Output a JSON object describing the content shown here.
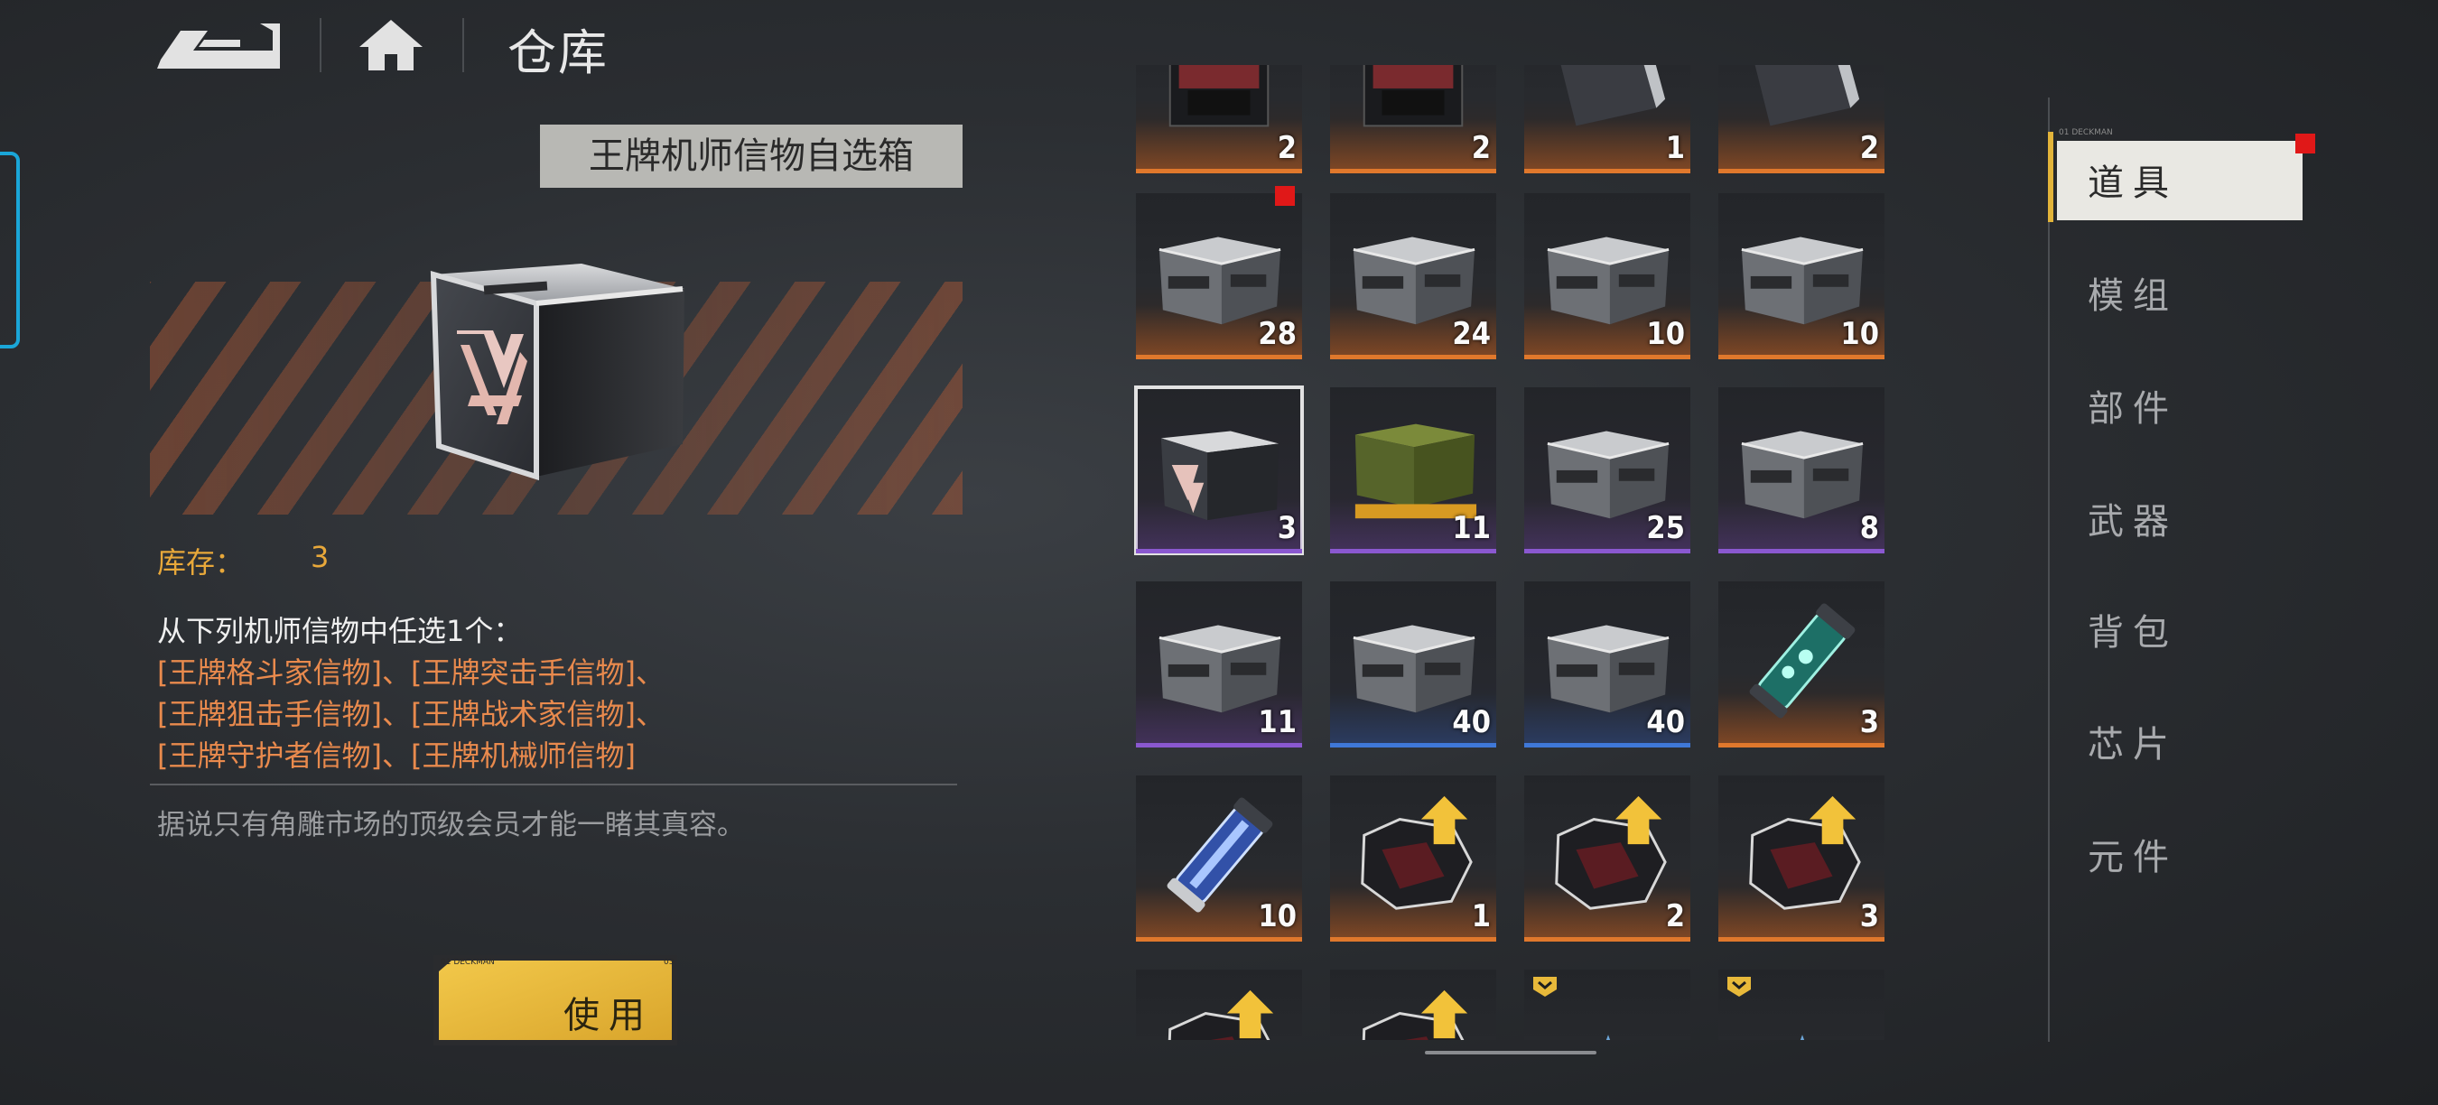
{
  "header": {
    "title": "仓库"
  },
  "detail": {
    "item_name": "王牌机师信物自选箱",
    "stock_label": "库存：",
    "stock_value": "3",
    "desc_intro": "从下列机师信物中任选1个：",
    "desc_lines": [
      "[王牌格斗家信物]、[王牌突击手信物]、",
      "[王牌狙击手信物]、[王牌战术家信物]、",
      "[王牌守护者信物]、[王牌机械师信物]"
    ],
    "flavor": "据说只有角雕市场的顶级会员才能一睹其真容。"
  },
  "use_button": {
    "label": "使用",
    "tag": "01 DECKMAN",
    "code": "03"
  },
  "tabs": {
    "code": "01 DECKMAN",
    "items": [
      {
        "label": "道具",
        "active": true,
        "new": true
      },
      {
        "label": "模组"
      },
      {
        "label": "部件"
      },
      {
        "label": "武器"
      },
      {
        "label": "背包"
      },
      {
        "label": "芯片"
      },
      {
        "label": "元件"
      }
    ]
  },
  "grid": {
    "rows": [
      [
        {
          "count": "2",
          "rarity": "orange",
          "icon": "pilot-card-icon"
        },
        {
          "count": "2",
          "rarity": "orange",
          "icon": "pilot-card-icon"
        },
        {
          "count": "1",
          "rarity": "orange",
          "icon": "device-icon"
        },
        {
          "count": "2",
          "rarity": "orange",
          "icon": "device-icon"
        }
      ],
      [
        {
          "count": "28",
          "rarity": "orange",
          "icon": "supply-crate-icon",
          "new": true
        },
        {
          "count": "24",
          "rarity": "orange",
          "icon": "supply-crate-icon"
        },
        {
          "count": "10",
          "rarity": "orange",
          "icon": "supply-crate-icon"
        },
        {
          "count": "10",
          "rarity": "orange",
          "icon": "supply-crate-icon"
        }
      ],
      [
        {
          "count": "3",
          "rarity": "purple",
          "icon": "ace-box-icon",
          "selected": true
        },
        {
          "count": "11",
          "rarity": "purple",
          "icon": "military-crate-icon"
        },
        {
          "count": "25",
          "rarity": "purple",
          "icon": "supply-crate-icon"
        },
        {
          "count": "8",
          "rarity": "purple",
          "icon": "supply-crate-icon"
        }
      ],
      [
        {
          "count": "11",
          "rarity": "purple",
          "icon": "supply-crate-icon"
        },
        {
          "count": "40",
          "rarity": "blue",
          "icon": "supply-crate-icon"
        },
        {
          "count": "40",
          "rarity": "blue",
          "icon": "supply-crate-icon"
        },
        {
          "count": "3",
          "rarity": "orange",
          "icon": "cyan-capsule-icon"
        }
      ],
      [
        {
          "count": "10",
          "rarity": "orange",
          "icon": "blue-capsule-icon"
        },
        {
          "count": "1",
          "rarity": "orange",
          "icon": "upgrade-part-icon"
        },
        {
          "count": "2",
          "rarity": "orange",
          "icon": "upgrade-part-icon"
        },
        {
          "count": "3",
          "rarity": "orange",
          "icon": "upgrade-part-icon"
        }
      ],
      [
        {
          "count": "",
          "rarity": "orange",
          "icon": "upgrade-part-icon"
        },
        {
          "count": "",
          "rarity": "orange",
          "icon": "upgrade-part-icon"
        },
        {
          "count": "",
          "rarity": "orange",
          "icon": "blueprint-icon",
          "badge": true
        },
        {
          "count": "",
          "rarity": "orange",
          "icon": "blueprint-icon",
          "badge": true
        }
      ]
    ]
  },
  "colors": {
    "accent_yellow": "#e8b93a",
    "rarity_orange": "#e0782c",
    "rarity_purple": "#8a58d0",
    "rarity_blue": "#3f78d8",
    "text_orange": "#e98a4d",
    "new_red": "#e01818"
  }
}
